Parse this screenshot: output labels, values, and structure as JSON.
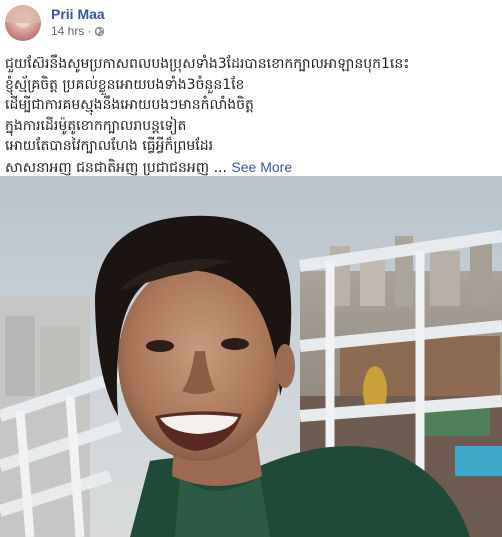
{
  "post": {
    "author_name": "Prii Maa",
    "timestamp": "14 hrs",
    "separator": "·",
    "privacy_icon": "globe-icon",
    "text_lines": [
      "ជួយស៊ែរនឹងសូមប្រកាសពលបងប្រុសទាំង3ដែរបានខោកក្បាលអាឡានបុក1នេះ",
      "ខ្ញុំស្ម័គ្រចិត្ត ប្រគល់ខ្លួនអោយបងទាំង3ចំនួន1ខែ",
      "ដើម្បីជាការគមស្មុងនឹងអោយបងៗមានកំលាំងចិត្ត",
      "ក្នុងការដើរម៉ូតូខោកក្បាលរាបន្តទៀត",
      "អោយតែបានវៃក្បាលហែង ធ្វើអ្វីក៏ព្រមដែរ"
    ],
    "last_line": "សាសនាអញ ជនជាតិអញ ប្រជាជនអញ",
    "ellipsis": "...",
    "see_more_label": "See More",
    "photo_icon": "photo-image"
  }
}
